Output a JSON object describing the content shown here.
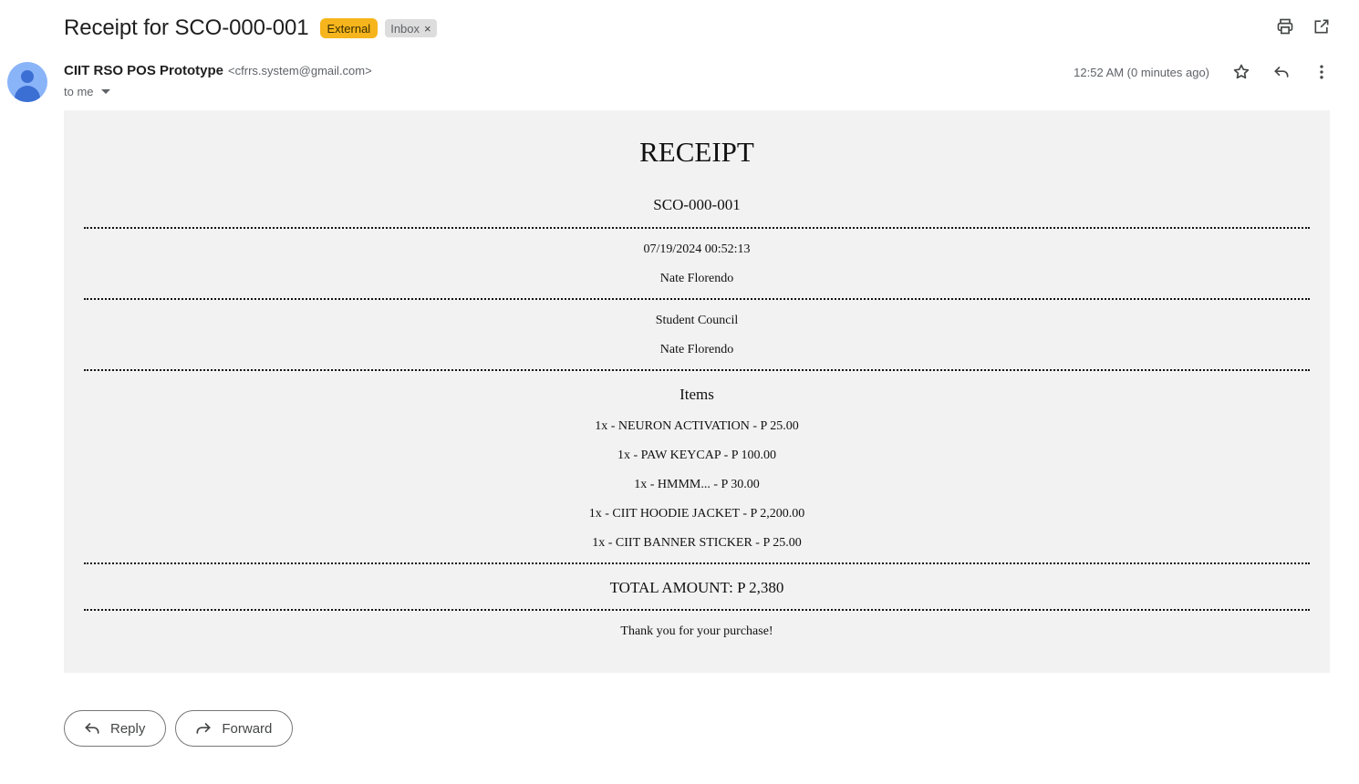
{
  "subject": "Receipt for SCO-000-001",
  "labels": {
    "external": "External",
    "inbox": "Inbox",
    "inbox_remove": "×"
  },
  "sender": {
    "name": "CIIT RSO POS Prototype",
    "email": "<cfrrs.system@gmail.com>"
  },
  "recipient": "to me",
  "timestamp": "12:52 AM (0 minutes ago)",
  "colors": {
    "external_badge": "#f6b51c",
    "receipt_bg": "#f2f2f2",
    "avatar": "#8ab4f8"
  },
  "receipt": {
    "title": "RECEIPT",
    "order_id": "SCO-000-001",
    "datetime": "07/19/2024 00:52:13",
    "customer": "Nate Florendo",
    "organization": "Student Council",
    "cashier": "Nate Florendo",
    "items_heading": "Items",
    "items": [
      "1x - NEURON ACTIVATION - P 25.00",
      "1x - PAW KEYCAP - P 100.00",
      "1x - HMMM... - P 30.00",
      "1x - CIIT HOODIE JACKET - P 2,200.00",
      "1x - CIIT BANNER STICKER - P 25.00"
    ],
    "total": "TOTAL AMOUNT: P 2,380",
    "thanks": "Thank you for your purchase!"
  },
  "actions": {
    "reply": "Reply",
    "forward": "Forward"
  },
  "icons": [
    "print-icon",
    "open-in-new-window-icon",
    "star-icon",
    "reply-icon",
    "more-vert-icon",
    "forward-icon"
  ]
}
